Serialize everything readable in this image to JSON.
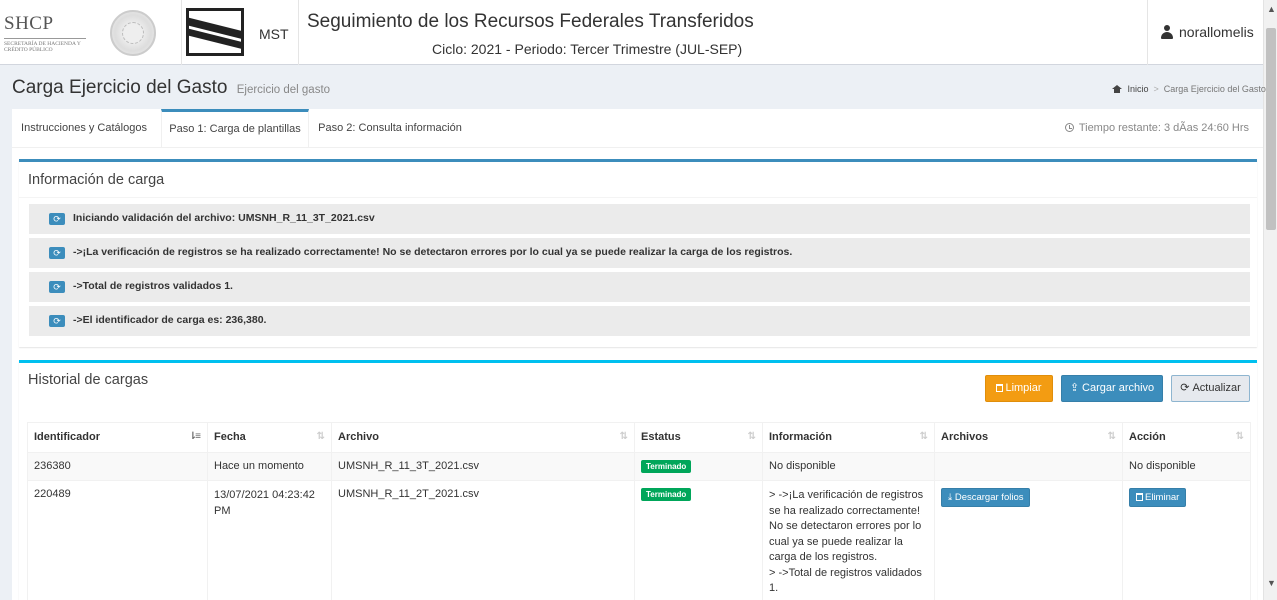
{
  "header": {
    "shcp_logo": "SHCP",
    "shcp_subtitle": "SECRETARÍA DE HACIENDA Y CRÉDITO PÚBLICO",
    "mst_label": "MST",
    "title": "Seguimiento de los Recursos Federales Transferidos",
    "subtitle": "Ciclo: 2021 - Periodo: Tercer Trimestre (JUL-SEP)",
    "user": "norallomelis"
  },
  "page": {
    "title": "Carga Ejercicio del Gasto",
    "subtitle": "Ejercicio del gasto",
    "breadcrumb_home": "Inicio",
    "breadcrumb_current": "Carga Ejercicio del Gasto"
  },
  "tabs": [
    {
      "label": "Instrucciones y Catálogos"
    },
    {
      "label": "Paso 1: Carga de plantillas",
      "active": true
    },
    {
      "label": "Paso 2: Consulta información"
    }
  ],
  "time_remaining": "Tiempo restante: 3 dÃas 24:60 Hrs",
  "info_box": {
    "title": "Información de carga",
    "messages": [
      "Iniciando validación del archivo: UMSNH_R_11_3T_2021.csv",
      "->¡La verificación de registros se ha realizado correctamente! No se detectaron errores por lo cual ya se puede realizar la carga de los registros.",
      "->Total de registros validados 1.",
      "->El identificador de carga es: 236,380."
    ]
  },
  "history_box": {
    "title": "Historial de cargas",
    "buttons": {
      "clear": "Limpiar",
      "upload": "Cargar archivo",
      "refresh": "Actualizar"
    },
    "columns": [
      "Identificador",
      "Fecha",
      "Archivo",
      "Estatus",
      "Información",
      "Archivos",
      "Acción"
    ],
    "rows": [
      {
        "id": "236380",
        "date": "Hace un momento",
        "file": "UMSNH_R_11_3T_2021.csv",
        "status": "Terminado",
        "info": "No disponible",
        "files_action": "",
        "action": "No disponible"
      },
      {
        "id": "220489",
        "date": "13/07/2021 04:23:42 PM",
        "file": "UMSNH_R_11_2T_2021.csv",
        "status": "Terminado",
        "info": "> ->¡La verificación de registros se ha realizado correctamente! No se detectaron errores por lo cual ya se puede realizar la carga de los registros.\n> ->Total de registros validados 1.",
        "files_action": "Descargar folios",
        "action": "Eliminar"
      }
    ]
  },
  "colors": {
    "primary": "#3c8dbc",
    "warning": "#f39c12",
    "success": "#00a65a",
    "info": "#00c0ef"
  }
}
